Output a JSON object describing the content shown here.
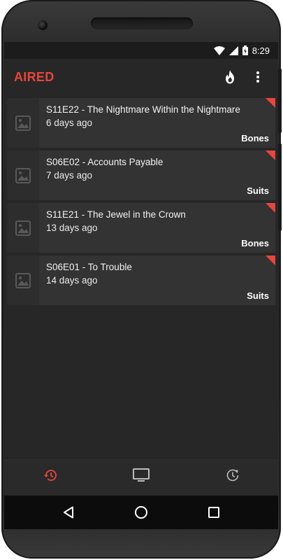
{
  "status_bar": {
    "time": "8:29"
  },
  "app_bar": {
    "title": "AIRED",
    "icons": [
      "flame-icon",
      "more-vert-icon"
    ]
  },
  "episodes": [
    {
      "title": "S11E22 - The Nightmare Within the Nightmare",
      "aired": "6 days ago",
      "show": "Bones"
    },
    {
      "title": "S06E02 - Accounts Payable",
      "aired": "7 days ago",
      "show": "Suits"
    },
    {
      "title": "S11E21 - The Jewel in the Crown",
      "aired": "13 days ago",
      "show": "Bones"
    },
    {
      "title": "S06E01 - To Trouble",
      "aired": "14 days ago",
      "show": "Suits"
    }
  ],
  "bottom_nav": {
    "items": [
      "history-icon",
      "tv-icon",
      "upcoming-clock-icon"
    ],
    "active_index": 0
  },
  "system_nav": [
    "back-icon",
    "home-icon",
    "recents-icon"
  ],
  "colors": {
    "accent": "#e8453c",
    "background": "#272727",
    "card": "#333333"
  }
}
